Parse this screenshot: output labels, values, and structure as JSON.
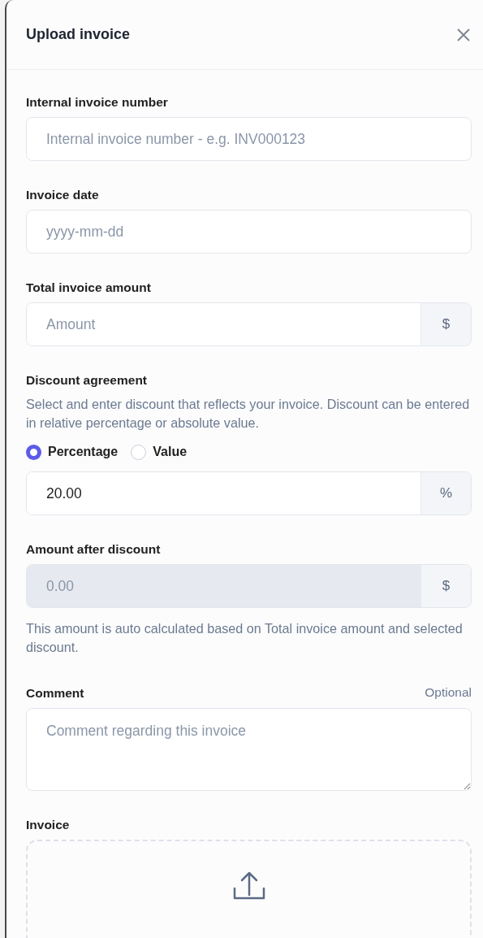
{
  "dialog": {
    "title": "Upload invoice"
  },
  "fields": [
    {
      "kind": "input",
      "label": "Internal invoice number",
      "placeholder": "Internal invoice number - e.g. INV000123"
    },
    {
      "kind": "input",
      "label": "Invoice date",
      "placeholder": "yyyy-mm-dd"
    },
    {
      "kind": "addon",
      "label": "Total invoice amount",
      "placeholder": "Amount",
      "addon": "$",
      "disabled": false
    },
    {
      "kind": "discount",
      "label": "Discount agreement",
      "description": "Select and enter discount that reflects your invoice. Discount can be entered in relative percentage or absolute value.",
      "options": [
        {
          "label": "Percentage",
          "selected": true
        },
        {
          "label": "Value",
          "selected": false
        }
      ],
      "value": "20.00",
      "addon": "%"
    },
    {
      "kind": "addon",
      "label": "Amount after discount",
      "value": "0.00",
      "addon": "$",
      "disabled": true,
      "help": "This amount is auto calculated based on Total invoice amount and selected discount."
    },
    {
      "kind": "textarea",
      "label": "Comment",
      "optional": "Optional",
      "placeholder": "Comment regarding this invoice"
    },
    {
      "kind": "dropzone",
      "label": "Invoice"
    }
  ]
}
